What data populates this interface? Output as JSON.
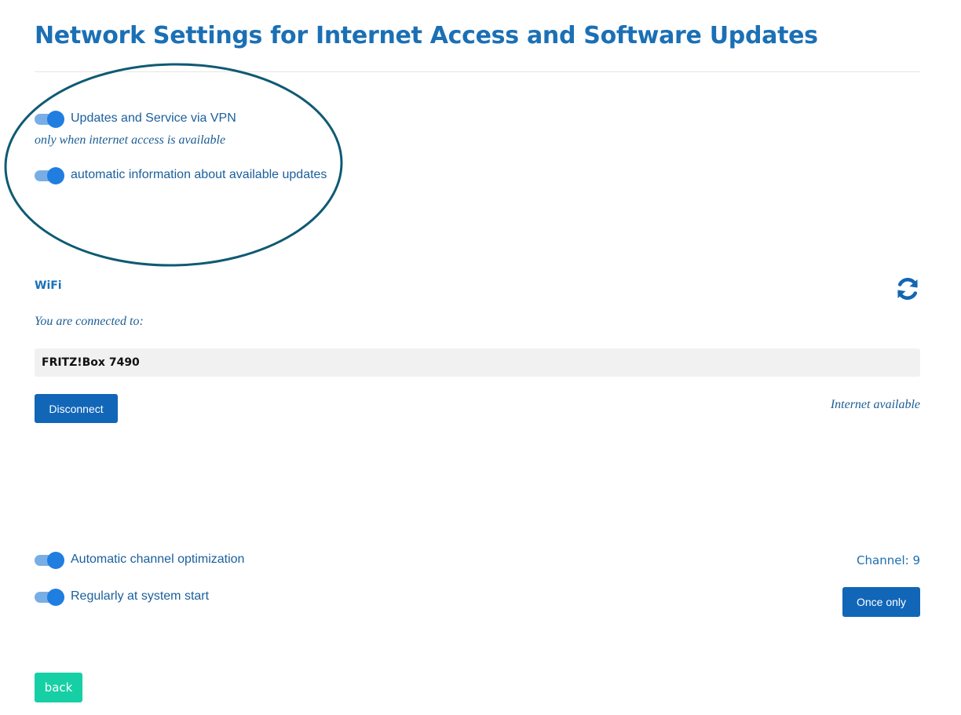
{
  "page": {
    "title": "Network Settings for Internet Access and Software Updates"
  },
  "updates": {
    "vpn_toggle": {
      "label": "Updates and Service via VPN",
      "checked": true
    },
    "vpn_hint": "only when internet access is available",
    "auto_info_toggle": {
      "label": "automatic information about available updates",
      "checked": true
    }
  },
  "wifi": {
    "section_title": "WiFi",
    "connected_label": "You are connected to:",
    "network_name": "FRITZ!Box 7490",
    "disconnect_label": "Disconnect",
    "internet_status": "Internet available",
    "refresh_icon": "refresh-icon"
  },
  "channel": {
    "auto_optimization_toggle": {
      "label": "Automatic channel optimization",
      "checked": true
    },
    "system_start_toggle": {
      "label": "Regularly at system start",
      "checked": true
    },
    "channel_text": "Channel: 9",
    "once_only_label": "Once only"
  },
  "footer": {
    "back_label": "back"
  },
  "colors": {
    "accent": "#1b70b5",
    "button": "#1166b8",
    "toggle_on": "#1f7ee0",
    "back_button": "#17cfa5",
    "annotation_ellipse": "#0f5a73"
  }
}
